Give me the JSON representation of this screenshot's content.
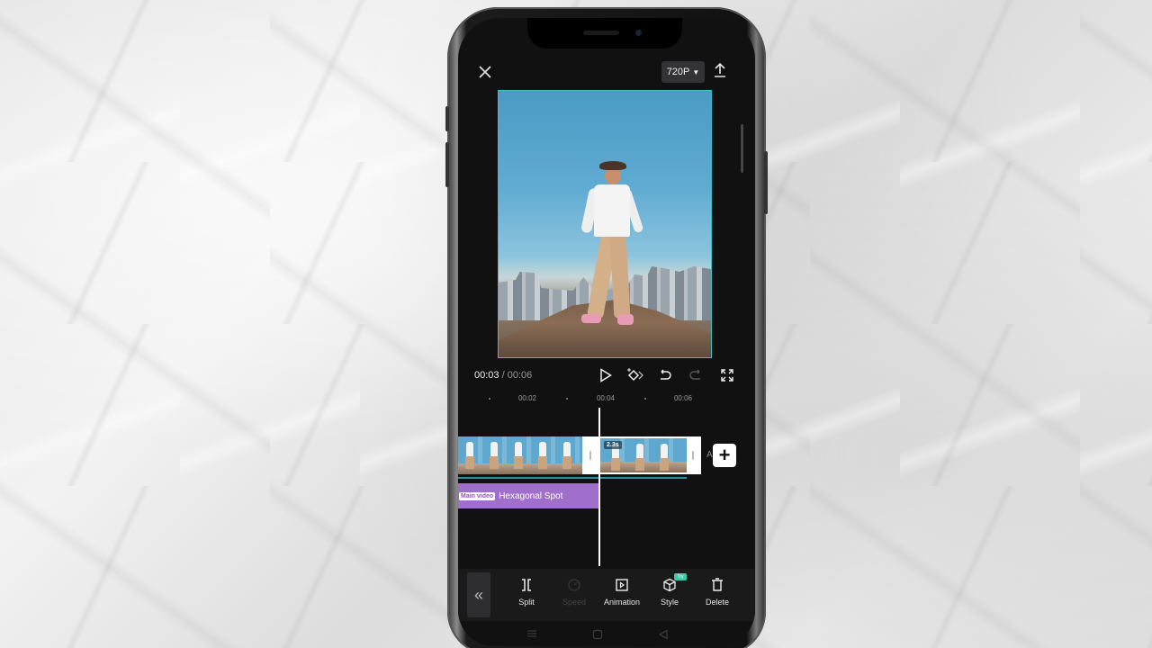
{
  "app": {
    "export_resolution": "720P",
    "icons": {
      "close": "close-icon",
      "resolution_caret": "caret-down-icon",
      "export": "upload-icon"
    }
  },
  "player": {
    "current_time": "00:03",
    "separator": " / ",
    "total_time": "00:06",
    "icons": [
      "play-icon",
      "keyframe-icon",
      "undo-icon",
      "redo-icon",
      "fullscreen-icon"
    ]
  },
  "timeline": {
    "ruler_ticks": [
      "00:02",
      "00:04",
      "00:06"
    ],
    "selected_clip_duration": "2.3s",
    "add_label_partial": "Add",
    "effect_track": {
      "tag": "Main video",
      "name": "Hexagonal Spot",
      "color": "#a06ecb"
    },
    "accent_color": "#2a8fa0"
  },
  "toolbar": {
    "collapse_icon": "double-chevron-left-icon",
    "tools": [
      {
        "label": "Split",
        "icon": "split-icon",
        "enabled": true
      },
      {
        "label": "Speed",
        "icon": "speed-icon",
        "enabled": false
      },
      {
        "label": "Animation",
        "icon": "animation-icon",
        "enabled": true
      },
      {
        "label": "Style",
        "icon": "cube-icon",
        "enabled": true,
        "badge": "Try"
      },
      {
        "label": "Delete",
        "icon": "trash-icon",
        "enabled": true
      }
    ]
  },
  "system_nav": [
    "menu-icon",
    "home-icon",
    "back-icon"
  ]
}
